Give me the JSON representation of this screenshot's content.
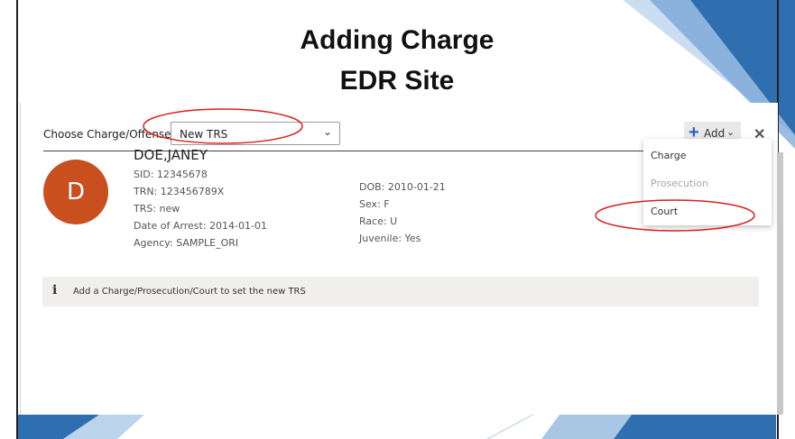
{
  "slide": {
    "title_line1": "Adding Charge",
    "title_line2": "EDR Site"
  },
  "toolbar": {
    "choose_label": "Choose Charge/Offense:",
    "select_value": "New TRS",
    "add_label": "Add"
  },
  "person": {
    "initial": "D",
    "name": "DOE,JANEY",
    "sid": "SID: 12345678",
    "trn": "TRN: 123456789X",
    "trs": "TRS: new",
    "arrest_date": "Date of Arrest: 2014-01-01",
    "agency": "Agency: SAMPLE_ORI",
    "dob": "DOB: 2010-01-21",
    "sex": "Sex: F",
    "race": "Race: U",
    "juvenile": "Juvenile: Yes"
  },
  "banner": {
    "icon": "info-icon",
    "text": "Add a Charge/Prosecution/Court to set the new TRS"
  },
  "add_menu": {
    "items": [
      "Charge",
      "Prosecution",
      "Court"
    ],
    "disabled": "Prosecution"
  },
  "colors": {
    "avatar": "#c94f1e",
    "accent_blue": "#2a64c5",
    "annotation_red": "#d9201f",
    "deco_blue": "#2f6fb0"
  }
}
